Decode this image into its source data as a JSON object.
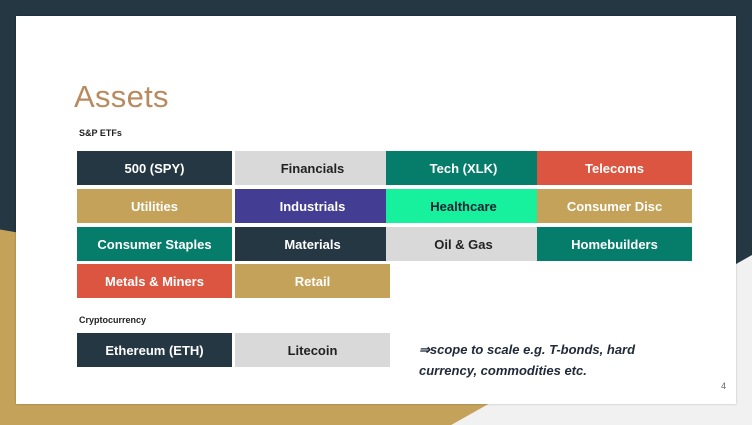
{
  "slide": {
    "title": "Assets",
    "page_number": "4"
  },
  "colors": {
    "dark": "#243742",
    "gray": "#d9d9d9",
    "teal": "#067c6a",
    "red": "#dc5540",
    "gold": "#c4a25a",
    "purple": "#433e93",
    "mint": "#17f09c",
    "title": "#b98a5e"
  },
  "etfs": {
    "label": "S&P ETFs",
    "tiles": [
      "500 (SPY)",
      "Financials",
      "Tech (XLK)",
      "Telecoms",
      "Utilities",
      "Industrials",
      "Healthcare",
      "Consumer Disc",
      "Consumer Staples",
      "Materials",
      "Oil & Gas",
      "Homebuilders",
      "Metals & Miners",
      "Retail"
    ]
  },
  "crypto": {
    "label": "Cryptocurrency",
    "tiles": [
      "Ethereum (ETH)",
      "Litecoin"
    ]
  },
  "note": {
    "text": "⇒scope to scale e.g. T-bonds, hard currency, commodities etc."
  }
}
